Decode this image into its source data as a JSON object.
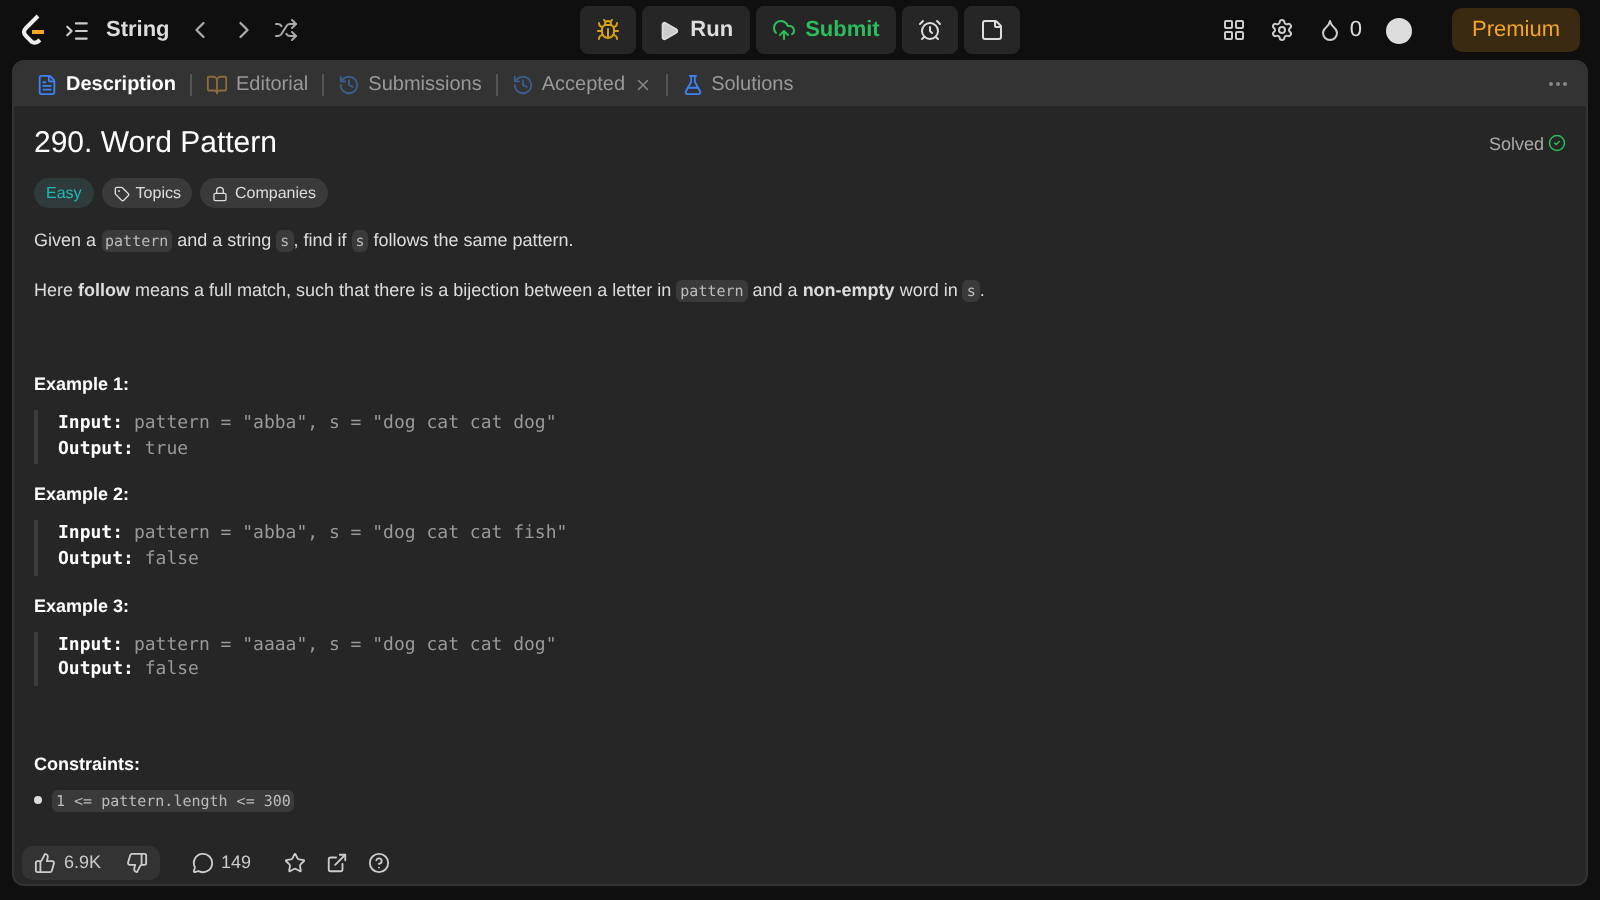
{
  "topbar": {
    "problem_list": "String",
    "run": "Run",
    "submit": "Submit",
    "streak": "0",
    "premium": "Premium"
  },
  "tabs": [
    {
      "label": "Description",
      "selected": true,
      "kind": "description",
      "closable": false
    },
    {
      "label": "Editorial",
      "selected": false,
      "kind": "editorial",
      "closable": false
    },
    {
      "label": "Submissions",
      "selected": false,
      "kind": "history",
      "closable": false
    },
    {
      "label": "Accepted",
      "selected": false,
      "kind": "history",
      "closable": true
    },
    {
      "label": "Solutions",
      "selected": false,
      "kind": "solutions",
      "closable": false
    }
  ],
  "problem": {
    "title": "290. Word Pattern",
    "status": "Solved",
    "difficulty": "Easy",
    "tags": [
      {
        "label": "Topics",
        "kind": "tag"
      },
      {
        "label": "Companies",
        "kind": "lock"
      }
    ],
    "paragraphs": [
      [
        {
          "kind": "text",
          "text": "Given a "
        },
        {
          "kind": "code",
          "text": "pattern"
        },
        {
          "kind": "text",
          "text": " and a string "
        },
        {
          "kind": "code",
          "text": "s"
        },
        {
          "kind": "text",
          "text": ", find if "
        },
        {
          "kind": "code",
          "text": "s"
        },
        {
          "kind": "text",
          "text": " follows the same pattern."
        }
      ],
      [
        {
          "kind": "text",
          "text": "Here **follow** means a full match, such that there is a bijection between a letter in "
        },
        {
          "kind": "code",
          "text": "pattern"
        },
        {
          "kind": "text",
          "text": " and a **non-empty** word in "
        },
        {
          "kind": "code",
          "text": "s"
        },
        {
          "kind": "text",
          "text": "."
        }
      ]
    ],
    "examples": [
      {
        "heading": "Example 1:",
        "input_label": "Input:",
        "input": "pattern = \"abba\", s = \"dog cat cat dog\"",
        "output_label": "Output:",
        "output": "true"
      },
      {
        "heading": "Example 2:",
        "input_label": "Input:",
        "input": "pattern = \"abba\", s = \"dog cat cat fish\"",
        "output_label": "Output:",
        "output": "false"
      },
      {
        "heading": "Example 3:",
        "input_label": "Input:",
        "input": "pattern = \"aaaa\", s = \"dog cat cat dog\"",
        "output_label": "Output:",
        "output": "false"
      }
    ],
    "constraints_heading": "Constraints:",
    "constraints": [
      "1 <= pattern.length <= 300"
    ]
  },
  "footer": {
    "likes": "6.9K",
    "comments": "149"
  }
}
